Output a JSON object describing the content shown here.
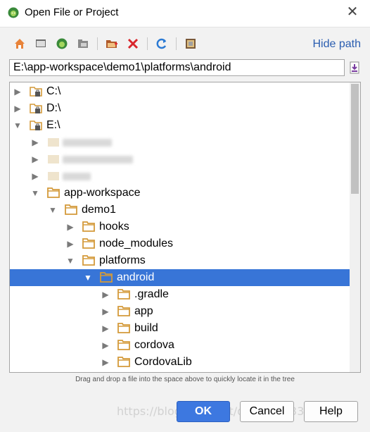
{
  "window": {
    "title": "Open File or Project",
    "close_glyph": "✕"
  },
  "toolbar": {
    "icons": [
      "home-icon",
      "desktop-icon",
      "project-icon",
      "module-icon",
      "new-folder-icon",
      "delete-icon",
      "refresh-icon",
      "show-hidden-icon"
    ],
    "hide_path_label": "Hide path"
  },
  "path": {
    "value": "E:\\app-workspace\\demo1\\platforms\\android"
  },
  "tree": {
    "rows": [
      {
        "label": "C:\\",
        "type": "drive",
        "expanded": false
      },
      {
        "label": "D:\\",
        "type": "drive",
        "expanded": false
      },
      {
        "label": "E:\\",
        "type": "drive",
        "expanded": true
      },
      {
        "label": "",
        "type": "blurred"
      },
      {
        "label": "",
        "type": "blurred"
      },
      {
        "label": "",
        "type": "blurred"
      },
      {
        "label": "app-workspace",
        "type": "folder",
        "expanded": true
      },
      {
        "label": "demo1",
        "type": "folder",
        "expanded": true
      },
      {
        "label": "hooks",
        "type": "folder",
        "expanded": false
      },
      {
        "label": "node_modules",
        "type": "folder",
        "expanded": false
      },
      {
        "label": "platforms",
        "type": "folder",
        "expanded": true
      },
      {
        "label": "android",
        "type": "folder",
        "expanded": true,
        "selected": true
      },
      {
        "label": ".gradle",
        "type": "folder",
        "expanded": false
      },
      {
        "label": "app",
        "type": "folder",
        "expanded": false
      },
      {
        "label": "build",
        "type": "folder",
        "expanded": false
      },
      {
        "label": "cordova",
        "type": "folder",
        "expanded": false
      },
      {
        "label": "CordovaLib",
        "type": "folder",
        "expanded": false
      }
    ]
  },
  "hint": "Drag and drop a file into the space above to quickly locate it in the tree",
  "buttons": {
    "ok": "OK",
    "cancel": "Cancel",
    "help": "Help"
  },
  "watermark": "https://blog.csdn.net/qq_xxx_33389",
  "colors": {
    "selection": "#3875d7",
    "folder": "#d49a3a",
    "link": "#2a5db0"
  }
}
